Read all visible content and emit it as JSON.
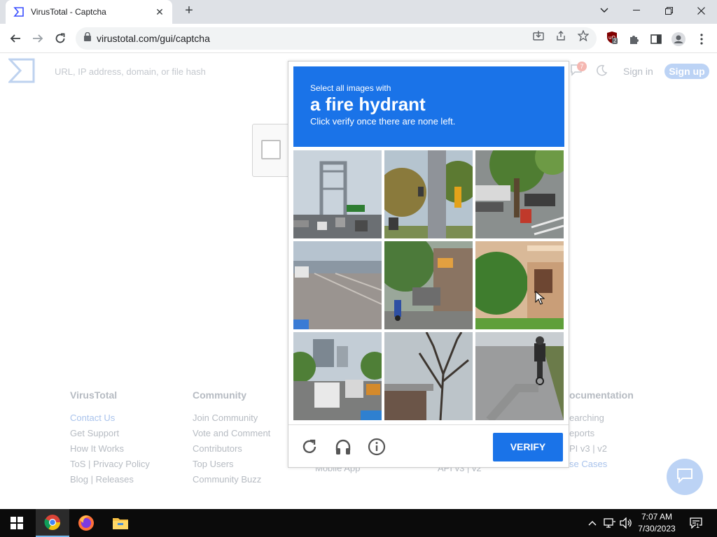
{
  "browser": {
    "tab_title": "VirusTotal - Captcha",
    "tab_close": "✕",
    "new_tab": "+",
    "url": "virustotal.com/gui/captcha",
    "extension_badge": "2"
  },
  "page": {
    "search_placeholder": "URL, IP address, domain, or file hash",
    "notification_count": "7",
    "sign_in": "Sign in",
    "sign_up": "Sign up",
    "footer": [
      {
        "heading": "VirusTotal",
        "links": [
          "Contact Us",
          "Get Support",
          "How It Works",
          "ToS | Privacy Policy",
          "Blog | Releases"
        ]
      },
      {
        "heading": "Community",
        "links": [
          "Join Community",
          "Vote and Comment",
          "Contributors",
          "Top Users",
          "Community Buzz"
        ]
      },
      {
        "heading": "",
        "links": [
          "",
          "",
          "",
          "",
          "Mobile App"
        ]
      },
      {
        "heading": "",
        "links": [
          "",
          "",
          "",
          "",
          "API v3 | v2"
        ]
      },
      {
        "heading": "ocumentation",
        "links": [
          "earching",
          "eports",
          "PI v3 | v2",
          "se Cases",
          ""
        ]
      }
    ]
  },
  "captcha": {
    "select_text": "Select all images with",
    "target": "a fire hydrant",
    "instruction": "Click verify once there are none left.",
    "verify_label": "VERIFY",
    "tiles": [
      "bridge-traffic",
      "traffic-light-pole",
      "parked-scooters",
      "highway",
      "street-motorbike",
      "house-plants",
      "city-traffic",
      "bare-tree",
      "cyclist-road"
    ],
    "colors": {
      "header": "#1a73e8",
      "button": "#1a73e8"
    }
  },
  "taskbar": {
    "time": "7:07 AM",
    "date": "7/30/2023",
    "notification_count": "1"
  }
}
